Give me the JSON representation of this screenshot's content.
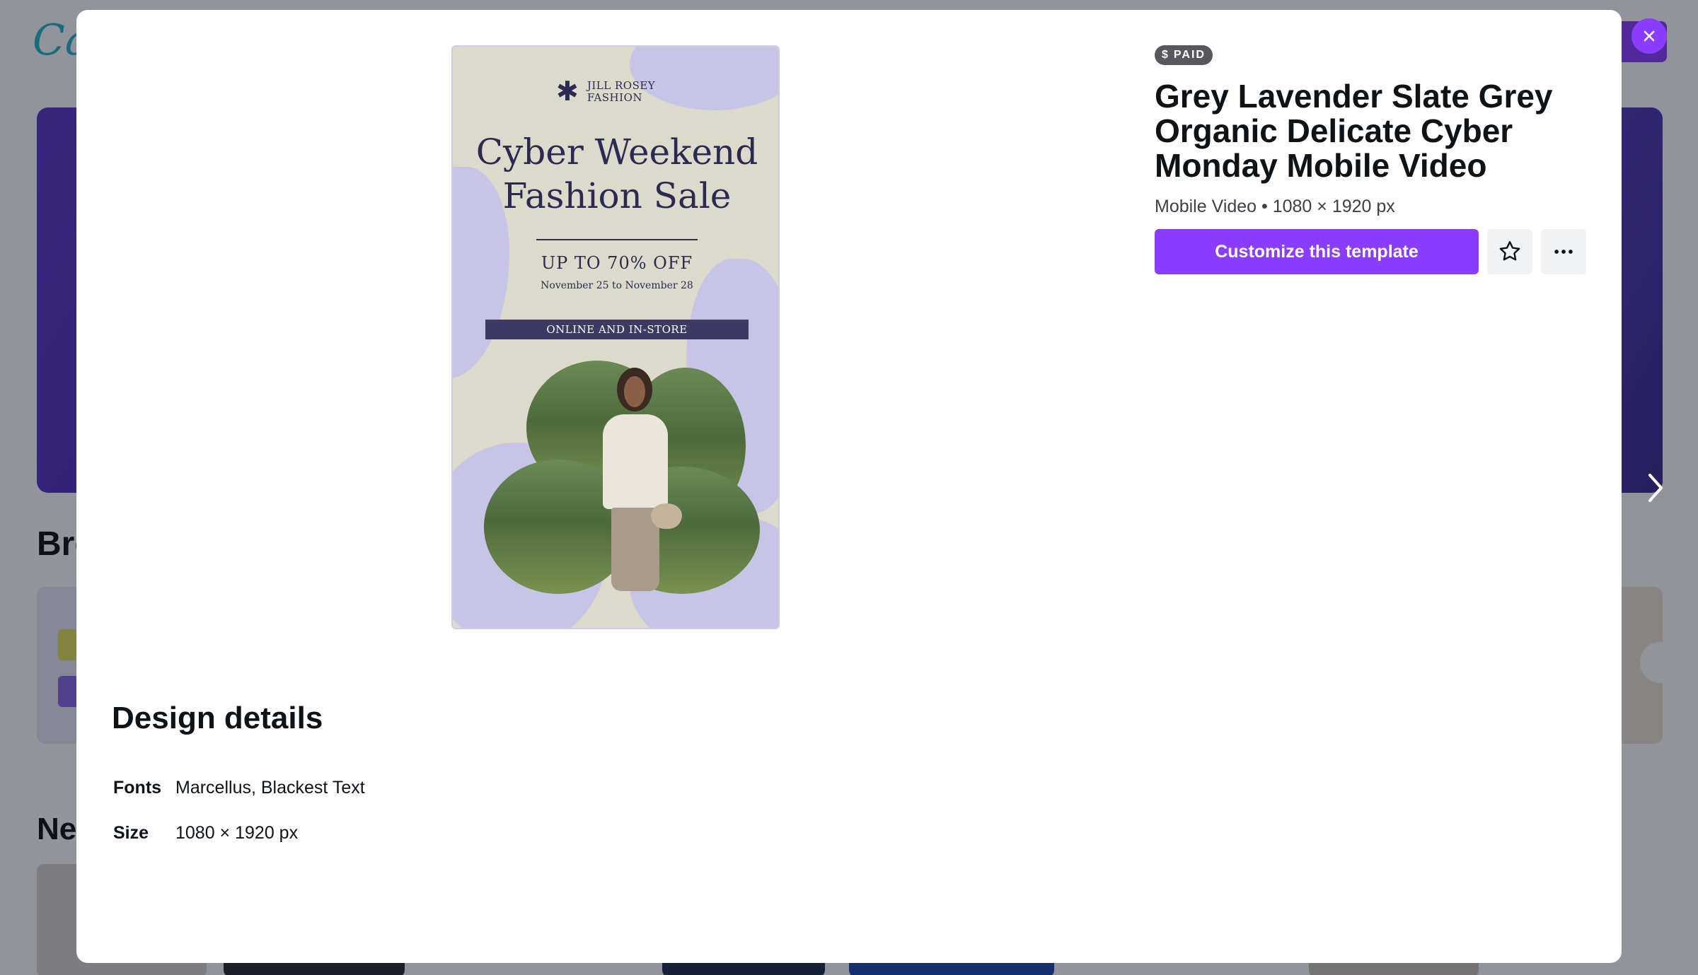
{
  "app": {
    "logo_text": "Canva"
  },
  "background": {
    "section_heading": "Brows",
    "section_heading_2": "New"
  },
  "template": {
    "badge_icon": "$",
    "badge_label": "PAID",
    "title": "Grey Lavender Slate Grey Organic Delicate Cyber Monday Mobile Video",
    "subtitle": "Mobile Video • 1080 × 1920 px",
    "customize_label": "Customize this template",
    "favorite_icon": "star-outline-icon",
    "more_icon": "more-horizontal-icon"
  },
  "preview": {
    "brand_line1": "JILL ROSEY",
    "brand_line2": "FASHION",
    "title": "Cyber Weekend Fashion Sale",
    "offer": "UP TO 70% OFF",
    "dates": "November 25 to November 28",
    "band": "ONLINE AND IN-STORE"
  },
  "details": {
    "heading": "Design details",
    "fonts_label": "Fonts",
    "fonts_value": "Marcellus, Blackest Text",
    "size_label": "Size",
    "size_value": "1080 × 1920 px"
  },
  "colors": {
    "accent": "#8b3dff",
    "preview_bg": "#dcdacb",
    "preview_lavender": "#c8c4e6",
    "preview_ink": "#2c2a52"
  }
}
